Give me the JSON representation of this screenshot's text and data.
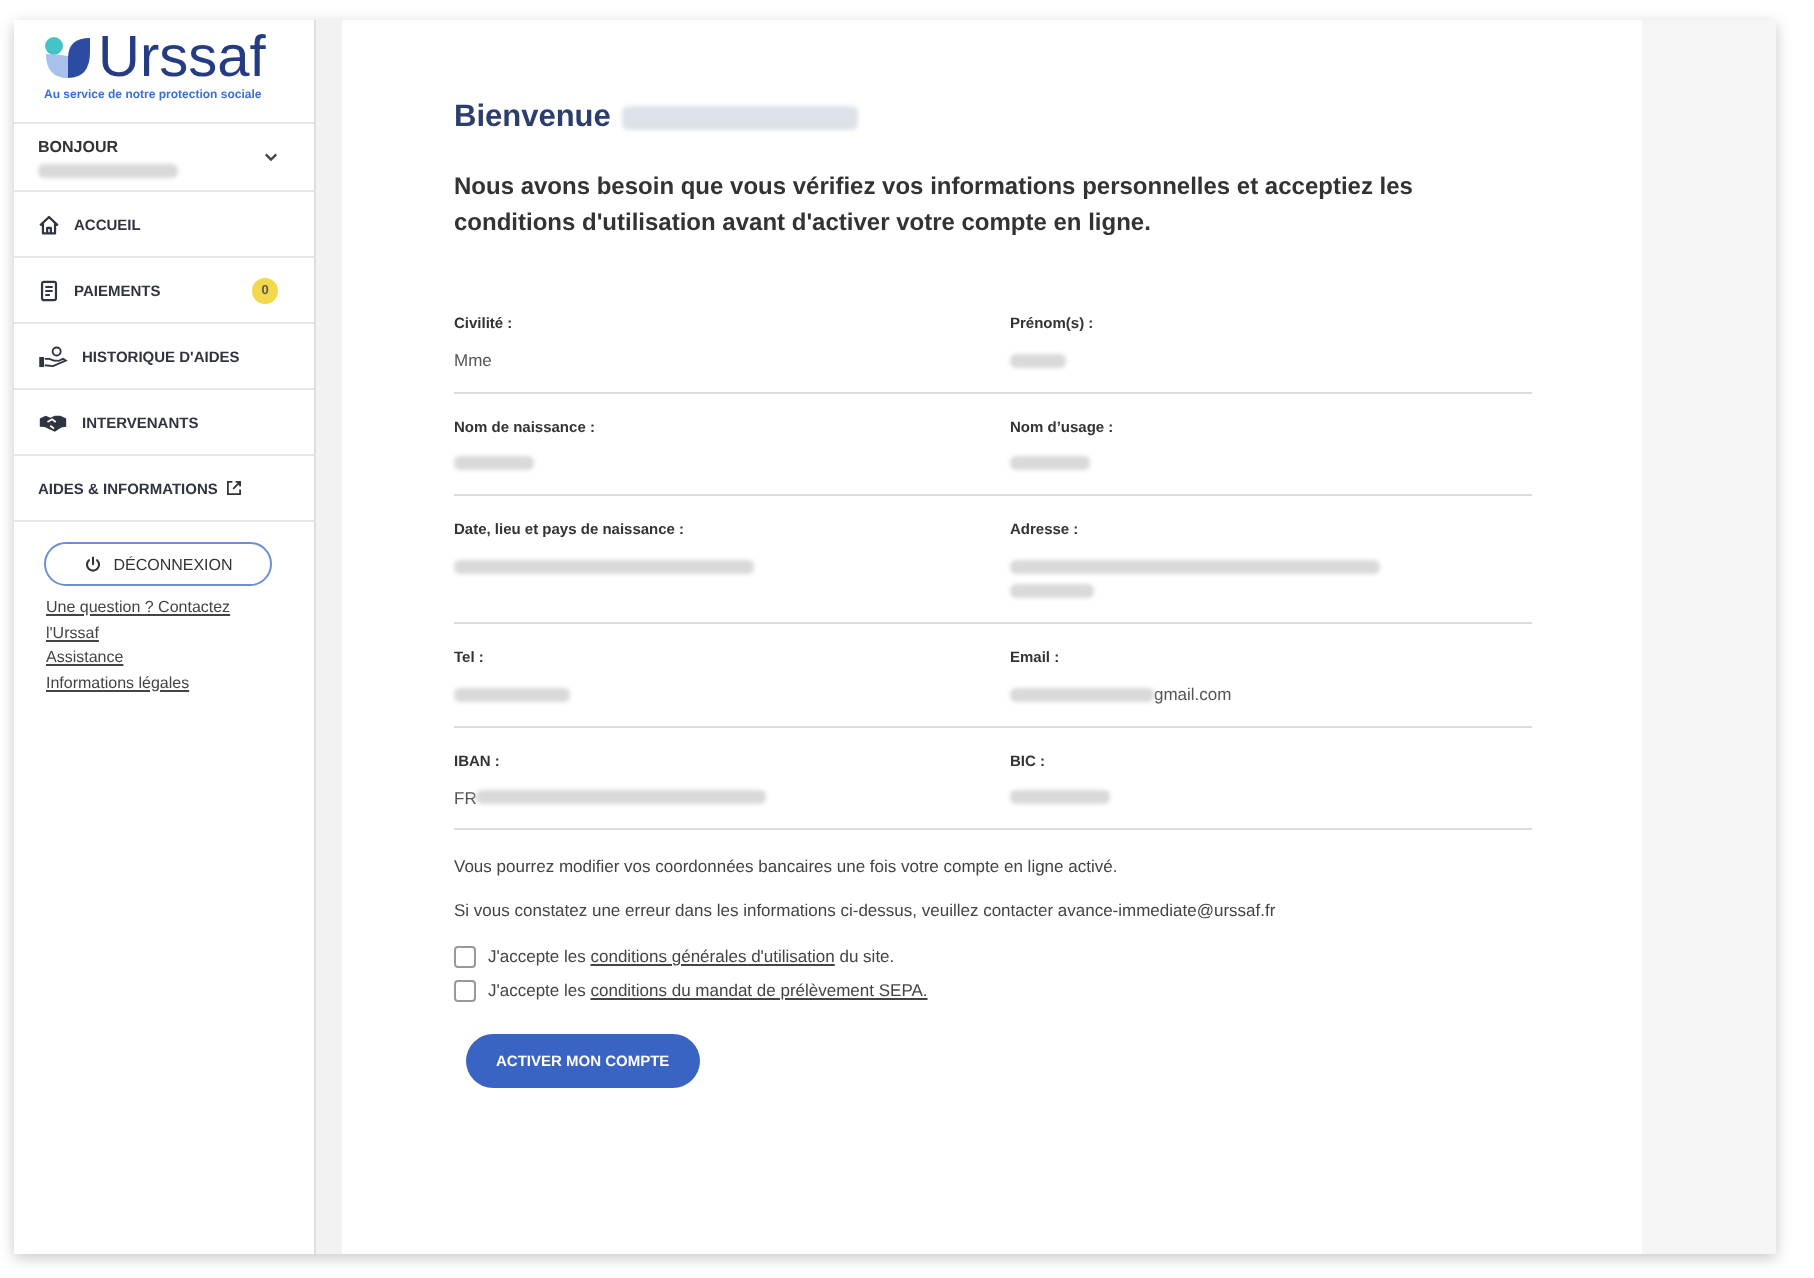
{
  "logo": {
    "name": "Urssaf",
    "tagline": "Au service de notre protection sociale"
  },
  "sidebar": {
    "account": {
      "label": "BONJOUR",
      "expanded": false,
      "value": [
        {
          "kind": "blurred"
        }
      ]
    },
    "items": [
      {
        "label": "ACCUEIL",
        "external": false
      },
      {
        "label": "PAIEMENTS",
        "badge": "0",
        "external": false
      },
      {
        "label": "HISTORIQUE D'AIDES",
        "external": false
      },
      {
        "label": "INTERVENANTS",
        "external": false
      },
      {
        "label": "AIDES & INFORMATIONS",
        "external": true
      }
    ],
    "logout": "DÉCONNEXION",
    "links": [
      "Une question ? Contactez l'Urssaf",
      "Assistance",
      "Informations légales"
    ]
  },
  "main": {
    "title": [
      {
        "kind": "text",
        "text": "Bienvenue"
      },
      {
        "kind": "blurred"
      }
    ],
    "intro": "Nous avons besoin que vous vérifiez vos informations personnelles et acceptiez les conditions d'utilisation avant d'activer votre compte en ligne.",
    "field_rows": [
      [
        {
          "label": "Civilité :",
          "lines": [
            [
              {
                "kind": "text",
                "text": "Mme"
              }
            ]
          ]
        },
        {
          "label": "Prénom(s) :",
          "lines": [
            [
              {
                "kind": "blurred"
              }
            ]
          ]
        }
      ],
      [
        {
          "label": "Nom de naissance :",
          "lines": [
            [
              {
                "kind": "blurred"
              }
            ]
          ]
        },
        {
          "label": "Nom d’usage :",
          "lines": [
            [
              {
                "kind": "blurred"
              }
            ]
          ]
        }
      ],
      [
        {
          "label": "Date, lieu et pays de naissance :",
          "lines": [
            [
              {
                "kind": "blurred"
              }
            ]
          ]
        },
        {
          "label": "Adresse :",
          "lines": [
            [
              {
                "kind": "blurred"
              }
            ],
            [
              {
                "kind": "blurred"
              }
            ]
          ]
        }
      ],
      [
        {
          "label": "Tel :",
          "lines": [
            [
              {
                "kind": "blurred"
              }
            ]
          ]
        },
        {
          "label": "Email :",
          "lines": [
            [
              {
                "kind": "blurred"
              },
              {
                "kind": "text",
                "text": "gmail.com"
              }
            ]
          ]
        }
      ],
      [
        {
          "label": "IBAN :",
          "lines": [
            [
              {
                "kind": "text",
                "text": "FR"
              },
              {
                "kind": "blurred"
              }
            ]
          ]
        },
        {
          "label": "BIC :",
          "lines": [
            [
              {
                "kind": "blurred"
              }
            ]
          ]
        }
      ]
    ],
    "notes": [
      "Vous pourrez modifier vos coordonnées bancaires une fois votre compte en ligne activé.",
      "Si vous constatez une erreur dans les informations ci-dessus, veuillez contacter avance-immediate@urssaf.fr"
    ],
    "consents": [
      {
        "checked": false,
        "before": "J'accepte les",
        "link": "conditions générales d'utilisation",
        "after": "du site."
      },
      {
        "checked": false,
        "before": "J'accepte les",
        "link": "conditions du mandat de prélèvement SEPA."
      }
    ],
    "submit": "ACTIVER MON COMPTE"
  }
}
